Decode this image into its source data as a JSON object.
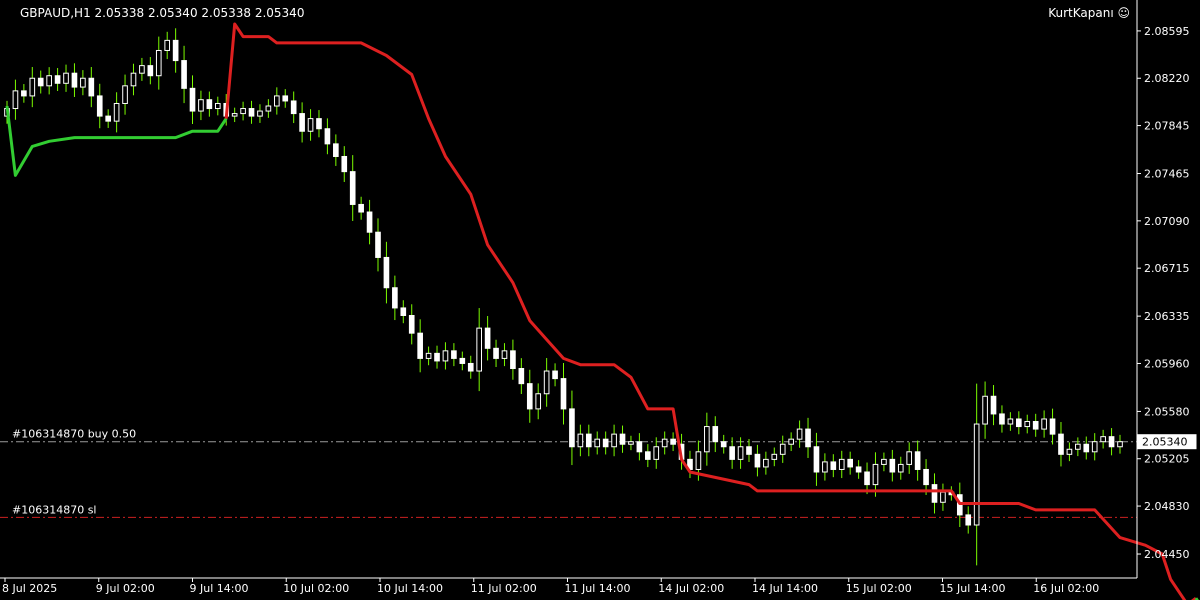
{
  "header": {
    "symbol_line": "GBPAUD,H1  2.05338 2.05340 2.05338 2.05340",
    "brand": "KurtKapanı ☺"
  },
  "chart_data": {
    "type": "candlestick",
    "symbol": "GBPAUD",
    "timeframe": "H1",
    "ohlc_header": [
      2.05338,
      2.0534,
      2.05338,
      2.0534
    ],
    "ylim": [
      2.0426,
      2.0884
    ],
    "y_ticks": [
      "2.08595",
      "2.08220",
      "2.07845",
      "2.07465",
      "2.07090",
      "2.06715",
      "2.06335",
      "2.05960",
      "2.05580",
      "2.05205",
      "2.04830",
      "2.04450"
    ],
    "x_ticks": [
      "8 Jul 2025",
      "9 Jul 02:00",
      "9 Jul 14:00",
      "10 Jul 02:00",
      "10 Jul 14:00",
      "11 Jul 02:00",
      "11 Jul 14:00",
      "14 Jul 02:00",
      "14 Jul 14:00",
      "15 Jul 02:00",
      "15 Jul 14:00",
      "16 Jul 02:00"
    ],
    "grid": false,
    "current_price": 2.0534,
    "current_price_label": "2.05340",
    "order_lines": [
      {
        "label": "#106314870 buy 0.50",
        "price": 2.0534,
        "color": "#9a9a9a",
        "style": "dash-dot"
      },
      {
        "label": "#106314870 sl",
        "price": 2.0474,
        "color": "#cc2020",
        "style": "dash-dot"
      }
    ],
    "candle_colors": {
      "bull": "#ffffff",
      "bear": "#ffffff",
      "wick": "#7cfc00"
    },
    "closes": [
      2.0798,
      2.0812,
      2.0808,
      2.0822,
      2.0816,
      2.0824,
      2.0818,
      2.0826,
      2.0815,
      2.0822,
      2.0808,
      2.0792,
      2.0788,
      2.0802,
      2.0816,
      2.0826,
      2.0832,
      2.0824,
      2.0844,
      2.0852,
      2.0836,
      2.0814,
      2.0796,
      2.0805,
      2.0798,
      2.0802,
      2.0792,
      2.0794,
      2.0798,
      2.0792,
      2.0796,
      2.08,
      2.0808,
      2.0804,
      2.0794,
      2.078,
      2.079,
      2.0782,
      2.077,
      2.076,
      2.0748,
      2.0722,
      2.0716,
      2.07,
      2.068,
      2.0656,
      2.064,
      2.0634,
      2.062,
      2.06,
      2.0604,
      2.0598,
      2.0606,
      2.06,
      2.0596,
      2.059,
      2.0624,
      2.0608,
      2.06,
      2.0606,
      2.0592,
      2.058,
      2.056,
      2.0572,
      2.059,
      2.0584,
      2.056,
      2.053,
      2.054,
      2.053,
      2.0536,
      2.053,
      2.054,
      2.0532,
      2.0534,
      2.0526,
      2.052,
      2.053,
      2.0536,
      2.0532,
      2.052,
      2.0512,
      2.0526,
      2.0546,
      2.0534,
      2.053,
      2.052,
      2.053,
      2.0524,
      2.0514,
      2.052,
      2.0524,
      2.0532,
      2.0536,
      2.0544,
      2.053,
      2.051,
      2.0518,
      2.0512,
      2.052,
      2.0514,
      2.051,
      2.05,
      2.0516,
      2.052,
      2.051,
      2.0516,
      2.0526,
      2.0512,
      2.05,
      2.0486,
      2.0494,
      2.0492,
      2.0476,
      2.0468,
      2.0548,
      2.057,
      2.0556,
      2.0548,
      2.0552,
      2.0546,
      2.055,
      2.0544,
      2.0552,
      2.054,
      2.0524,
      2.0528,
      2.0532,
      2.0526,
      2.0534,
      2.0538,
      2.053,
      2.0534
    ],
    "indicator": {
      "name": "",
      "colors": {
        "up": "#32cd32",
        "down": "#dd2020"
      },
      "segments": [
        {
          "trend": "up",
          "points": [
            [
              0,
              2.08
            ],
            [
              1,
              2.0745
            ],
            [
              3,
              2.0768
            ],
            [
              5,
              2.0772
            ],
            [
              8,
              2.0775
            ],
            [
              20,
              2.0775
            ],
            [
              22,
              2.078
            ],
            [
              25,
              2.078
            ],
            [
              26,
              2.079
            ]
          ]
        },
        {
          "trend": "down",
          "points": [
            [
              26,
              2.079
            ],
            [
              27,
              2.0865
            ],
            [
              28,
              2.0855
            ],
            [
              31,
              2.0855
            ],
            [
              32,
              2.085
            ],
            [
              42,
              2.085
            ],
            [
              45,
              2.084
            ],
            [
              48,
              2.0825
            ],
            [
              50,
              2.079
            ],
            [
              52,
              2.076
            ],
            [
              55,
              2.073
            ],
            [
              57,
              2.069
            ],
            [
              60,
              2.066
            ],
            [
              62,
              2.063
            ],
            [
              64,
              2.0615
            ],
            [
              66,
              2.06
            ],
            [
              68,
              2.0595
            ],
            [
              72,
              2.0595
            ],
            [
              74,
              2.0585
            ],
            [
              76,
              2.056
            ],
            [
              79,
              2.056
            ],
            [
              80,
              2.052
            ],
            [
              81,
              2.051
            ],
            [
              88,
              2.05
            ],
            [
              89,
              2.0495
            ],
            [
              112,
              2.0495
            ],
            [
              113,
              2.0485
            ],
            [
              120,
              2.0485
            ],
            [
              122,
              2.048
            ],
            [
              129,
              2.048
            ],
            [
              132,
              2.0458
            ],
            [
              135,
              2.0452
            ],
            [
              137,
              2.0445
            ],
            [
              138,
              2.0425
            ],
            [
              140,
              2.0405
            ],
            [
              141,
              2.041
            ]
          ]
        },
        {
          "trend": "up",
          "points": [
            [
              141,
              2.041
            ],
            [
              142,
              2.04
            ],
            [
              143,
              2.0418
            ],
            [
              145,
              2.0425
            ],
            [
              160,
              2.0425
            ]
          ]
        }
      ]
    }
  }
}
